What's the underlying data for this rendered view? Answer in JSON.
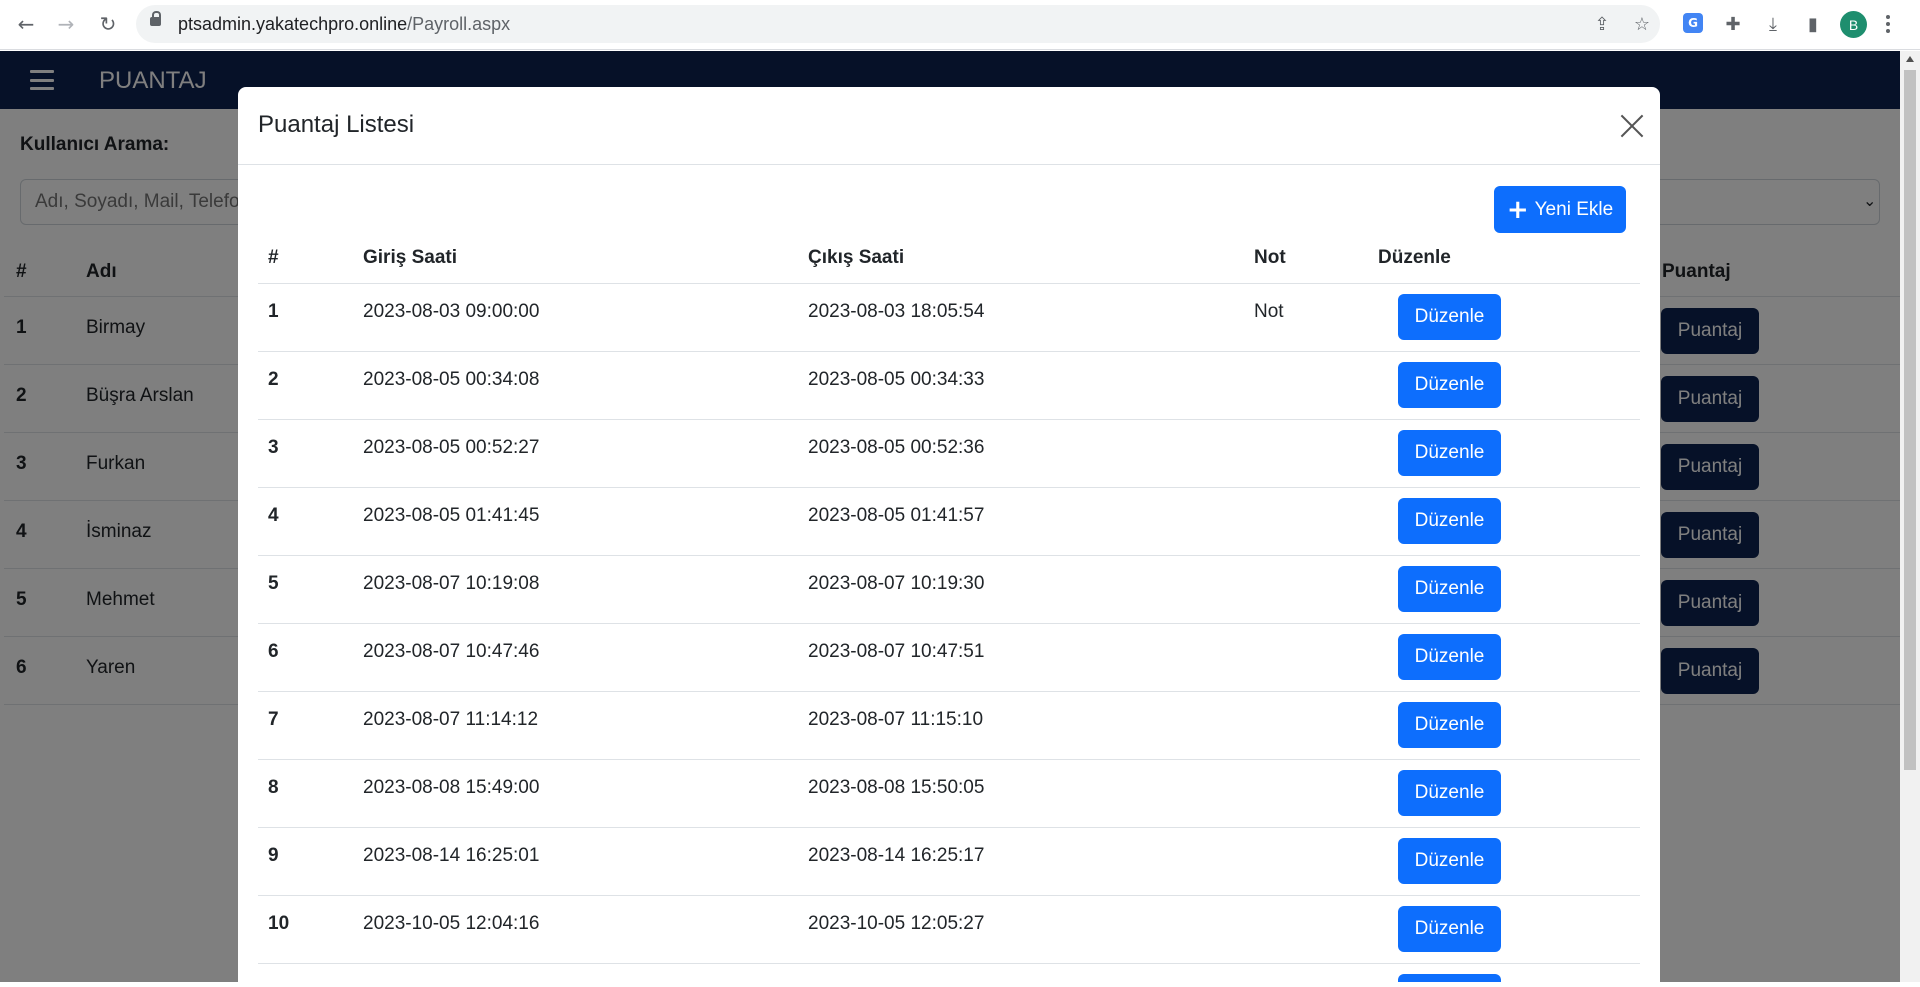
{
  "browser": {
    "url_host": "ptsadmin.yakatechpro.online",
    "url_path": "/Payroll.aspx",
    "profile_initial": "B",
    "icons": [
      "back-icon",
      "forward-icon",
      "reload-icon",
      "lock-icon",
      "share-icon",
      "star-icon",
      "translate-icon",
      "extensions-icon",
      "download-icon",
      "sidepanel-icon",
      "kebab-menu-icon"
    ]
  },
  "navbar": {
    "brand": "PUANTAJ"
  },
  "search": {
    "label": "Kullanıcı Arama:",
    "placeholder": "Adı, Soyadı, Mail, Telefon"
  },
  "users_table": {
    "headers": {
      "num": "#",
      "name": "Adı",
      "payroll": "Puantaj"
    },
    "rows": [
      {
        "num": "1",
        "name": "Birmay",
        "action": "Puantaj"
      },
      {
        "num": "2",
        "name": "Büşra Arslan",
        "action": "Puantaj"
      },
      {
        "num": "3",
        "name": "Furkan",
        "action": "Puantaj"
      },
      {
        "num": "4",
        "name": "İsminaz",
        "action": "Puantaj"
      },
      {
        "num": "5",
        "name": "Mehmet",
        "action": "Puantaj"
      },
      {
        "num": "6",
        "name": "Yaren",
        "action": "Puantaj"
      }
    ]
  },
  "modal": {
    "title": "Puantaj Listesi",
    "add_button": "Yeni Ekle",
    "headers": {
      "num": "#",
      "entry": "Giriş Saati",
      "exit": "Çıkış Saati",
      "note": "Not",
      "edit": "Düzenle"
    },
    "rows": [
      {
        "num": "1",
        "entry": "2023-08-03 09:00:00",
        "exit": "2023-08-03 18:05:54",
        "note": "Not",
        "edit": "Düzenle"
      },
      {
        "num": "2",
        "entry": "2023-08-05 00:34:08",
        "exit": "2023-08-05 00:34:33",
        "note": "",
        "edit": "Düzenle"
      },
      {
        "num": "3",
        "entry": "2023-08-05 00:52:27",
        "exit": "2023-08-05 00:52:36",
        "note": "",
        "edit": "Düzenle"
      },
      {
        "num": "4",
        "entry": "2023-08-05 01:41:45",
        "exit": "2023-08-05 01:41:57",
        "note": "",
        "edit": "Düzenle"
      },
      {
        "num": "5",
        "entry": "2023-08-07 10:19:08",
        "exit": "2023-08-07 10:19:30",
        "note": "",
        "edit": "Düzenle"
      },
      {
        "num": "6",
        "entry": "2023-08-07 10:47:46",
        "exit": "2023-08-07 10:47:51",
        "note": "",
        "edit": "Düzenle"
      },
      {
        "num": "7",
        "entry": "2023-08-07 11:14:12",
        "exit": "2023-08-07 11:15:10",
        "note": "",
        "edit": "Düzenle"
      },
      {
        "num": "8",
        "entry": "2023-08-08 15:49:00",
        "exit": "2023-08-08 15:50:05",
        "note": "",
        "edit": "Düzenle"
      },
      {
        "num": "9",
        "entry": "2023-08-14 16:25:01",
        "exit": "2023-08-14 16:25:17",
        "note": "",
        "edit": "Düzenle"
      },
      {
        "num": "10",
        "entry": "2023-10-05 12:04:16",
        "exit": "2023-10-05 12:05:27",
        "note": "",
        "edit": "Düzenle"
      }
    ]
  },
  "colors": {
    "navbar": "#0d2350",
    "primary_button": "#0d6efd",
    "payroll_button": "#0d2350"
  }
}
